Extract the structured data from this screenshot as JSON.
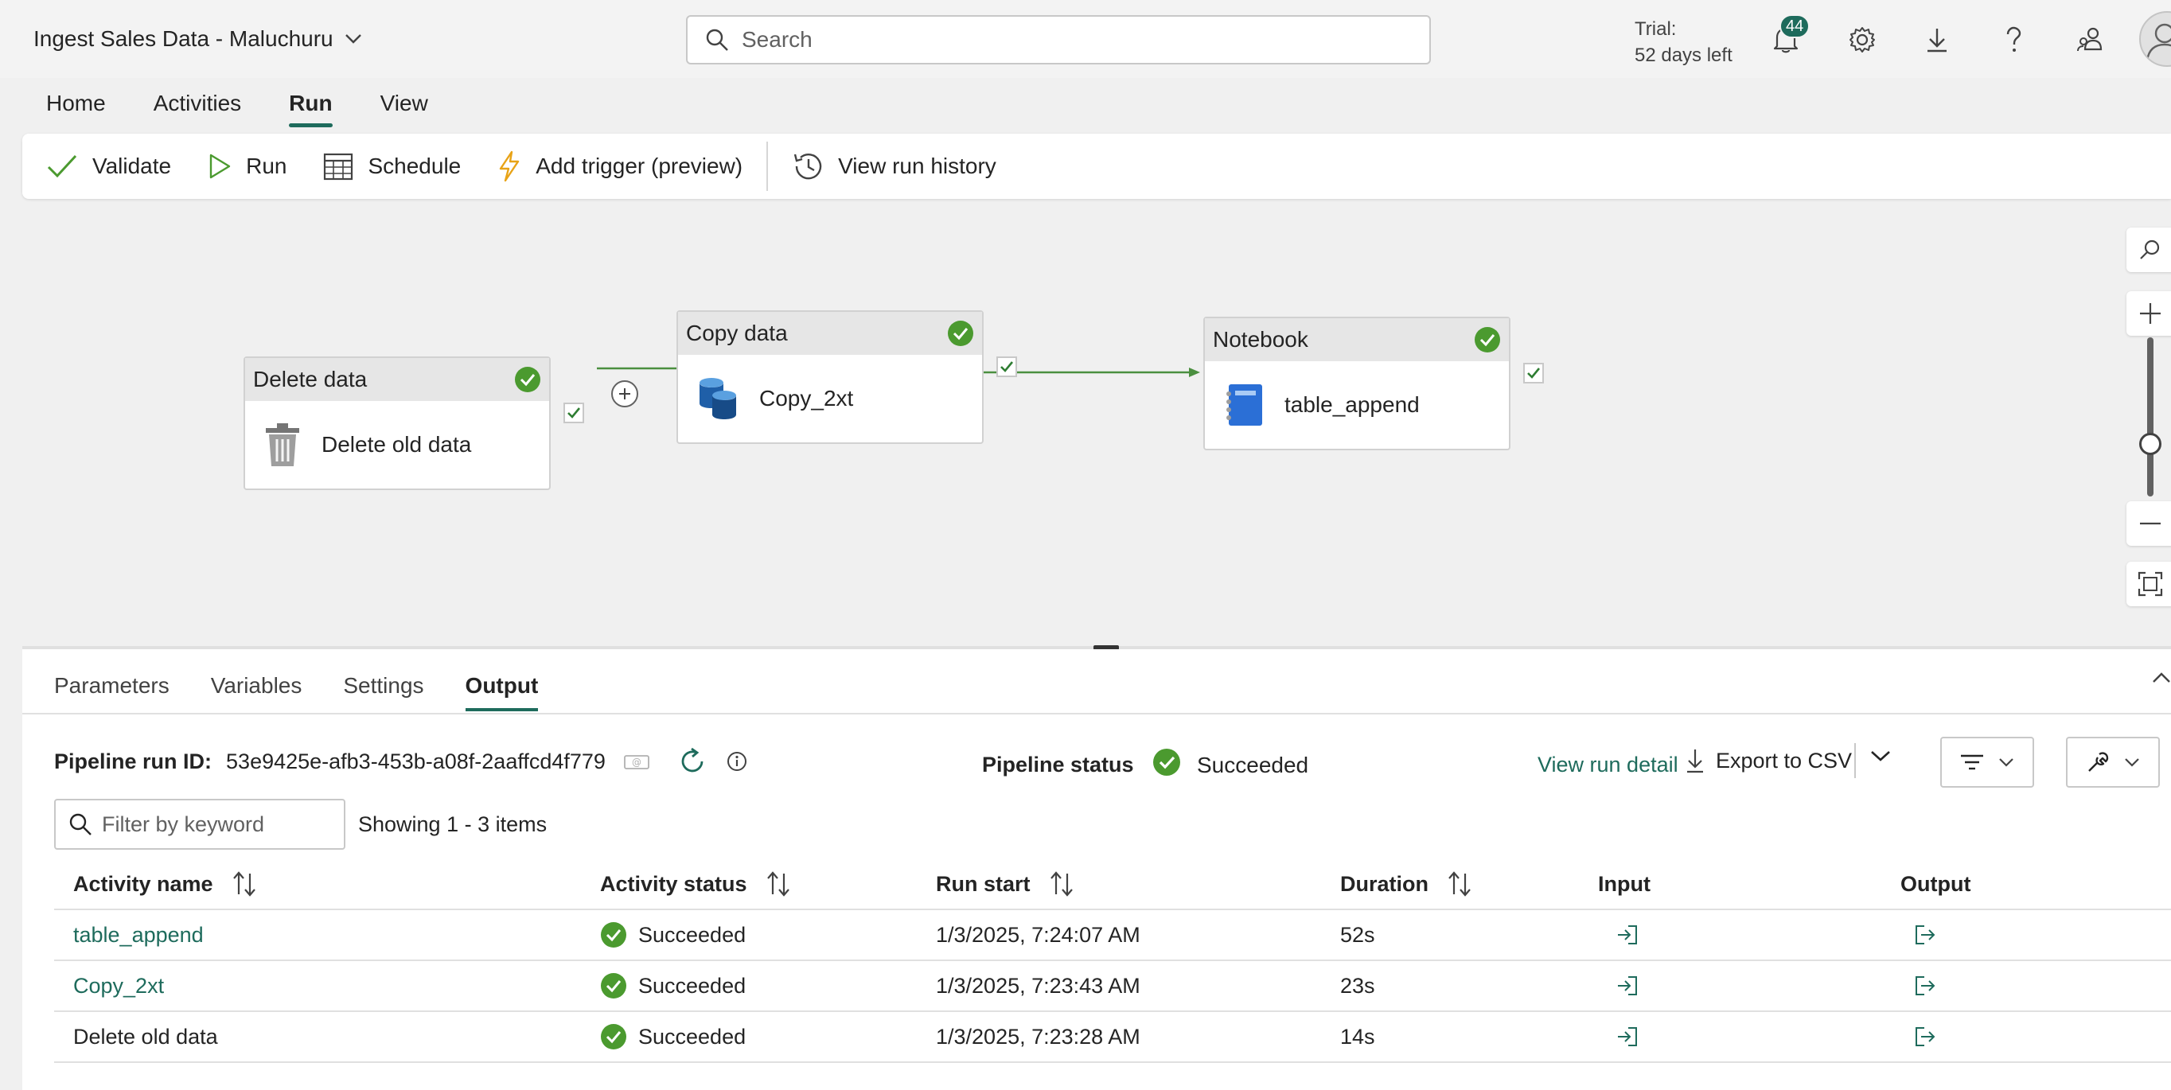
{
  "app": {
    "title": "Ingest Sales Data - Maluchuru",
    "search_placeholder": "Search",
    "trial_line1": "Trial:",
    "trial_line2": "52 days left",
    "notification_count": "44"
  },
  "menu": {
    "tabs": [
      "Home",
      "Activities",
      "Run",
      "View"
    ],
    "active": "Run"
  },
  "toolbar": {
    "validate": "Validate",
    "run": "Run",
    "schedule": "Schedule",
    "add_trigger": "Add trigger (preview)",
    "view_run_history": "View run history"
  },
  "canvas": {
    "activities": [
      {
        "type": "Delete data",
        "name": "Delete old data",
        "icon": "trash-icon"
      },
      {
        "type": "Copy data",
        "name": "Copy_2xt",
        "icon": "database-icon"
      },
      {
        "type": "Notebook",
        "name": "table_append",
        "icon": "notebook-icon"
      }
    ]
  },
  "bottom": {
    "tabs": [
      "Parameters",
      "Variables",
      "Settings",
      "Output"
    ],
    "active": "Output",
    "pipeline_run_id_label": "Pipeline run ID:",
    "pipeline_run_id": "53e9425e-afb3-453b-a08f-2aaffcd4f779",
    "pipeline_status_label": "Pipeline status",
    "pipeline_status": "Succeeded",
    "view_run_detail": "View run detail",
    "export_csv": "Export to CSV",
    "filter_placeholder": "Filter by keyword",
    "showing": "Showing 1 - 3 items",
    "columns": {
      "activity_name": "Activity name",
      "activity_status": "Activity status",
      "run_start": "Run start",
      "duration": "Duration",
      "input": "Input",
      "output": "Output"
    },
    "rows": [
      {
        "name": "table_append",
        "status": "Succeeded",
        "run_start": "1/3/2025, 7:24:07 AM",
        "duration": "52s"
      },
      {
        "name": "Copy_2xt",
        "status": "Succeeded",
        "run_start": "1/3/2025, 7:23:43 AM",
        "duration": "23s"
      },
      {
        "name": "Delete old data",
        "status": "Succeeded",
        "run_start": "1/3/2025, 7:23:28 AM",
        "duration": "14s"
      }
    ]
  },
  "colors": {
    "accent": "#1e6b5c",
    "success": "#4b9a2f"
  }
}
